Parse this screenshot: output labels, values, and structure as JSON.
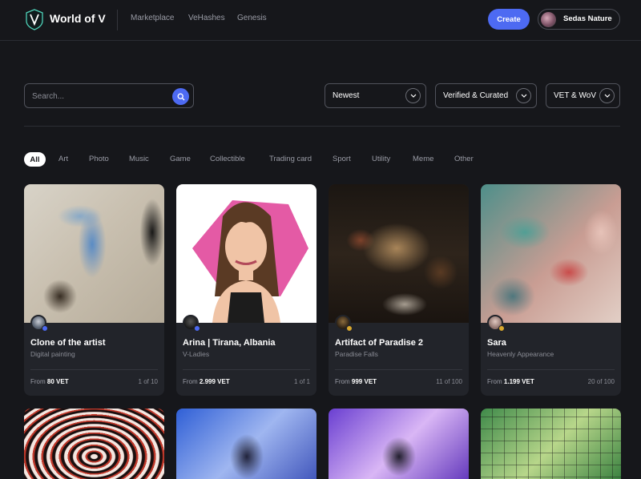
{
  "header": {
    "brand": "World of V",
    "nav": [
      "Marketplace",
      "VeHashes",
      "Genesis"
    ],
    "create_label": "Create",
    "user_name": "Sedas Nature"
  },
  "search": {
    "placeholder": "Search..."
  },
  "filters": {
    "sort": "Newest",
    "curation": "Verified & Curated",
    "currency": "VET & WoV"
  },
  "tabs": [
    "All",
    "Art",
    "Photo",
    "Music",
    "Game",
    "Collectible",
    "Trading card",
    "Sport",
    "Utility",
    "Meme",
    "Other"
  ],
  "cards": [
    {
      "title": "Clone of the artist",
      "subtitle": "Digital painting",
      "price_prefix": "From",
      "price": "80 VET",
      "edition": "1 of 10"
    },
    {
      "title": "Arina | Tirana, Albania",
      "subtitle": "V-Ladies",
      "price_prefix": "From",
      "price": "2.999 VET",
      "edition": "1 of 1"
    },
    {
      "title": "Artifact of Paradise 2",
      "subtitle": "Paradise Falls",
      "price_prefix": "From",
      "price": "999 VET",
      "edition": "11 of 100"
    },
    {
      "title": "Sara",
      "subtitle": "Heavenly Appearance",
      "price_prefix": "From",
      "price": "1.199 VET",
      "edition": "20 of 100"
    }
  ],
  "colors": {
    "background": "#16171b",
    "card": "#22242a",
    "accent": "#4d6af2",
    "verified_badge": "#4d6af2",
    "gold_badge": "#d9a82e"
  },
  "icons": {
    "logo": "v-shield-logo-icon",
    "search": "search-icon",
    "chevron": "chevron-down-icon",
    "verified": "verified-badge-icon"
  }
}
